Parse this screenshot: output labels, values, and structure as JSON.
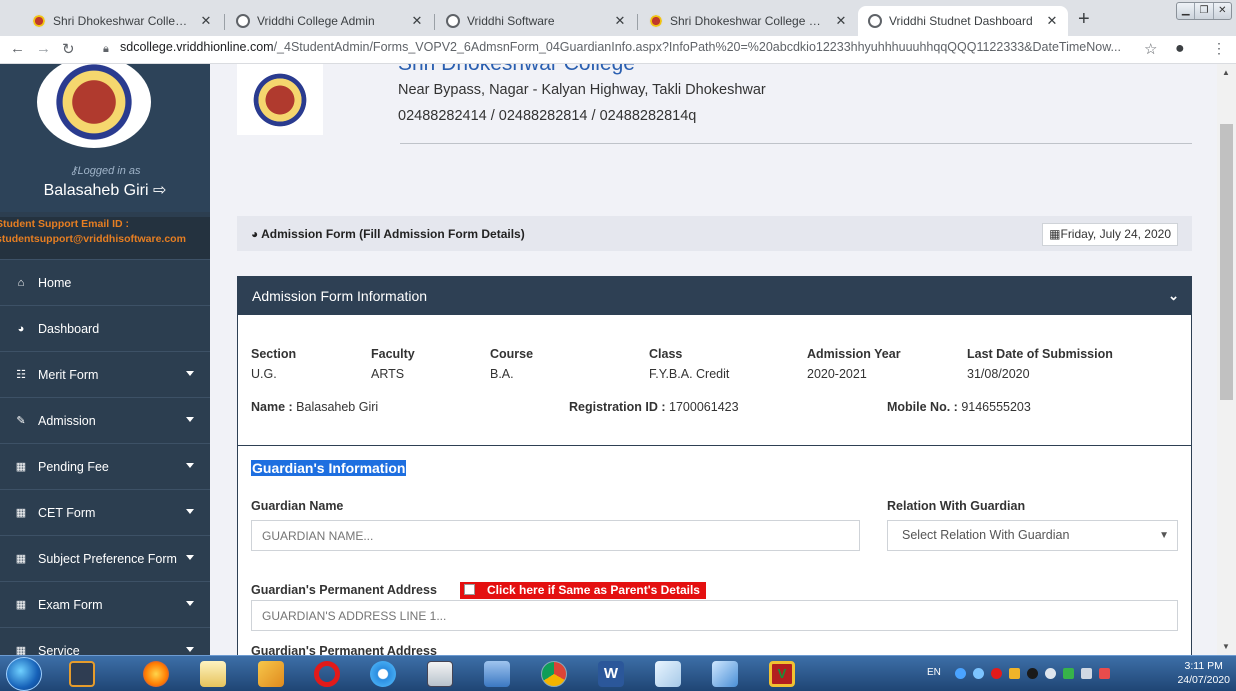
{
  "browser": {
    "tabs": [
      {
        "title": "Shri Dhokeshwar College – A/P. T",
        "active": false
      },
      {
        "title": "Vriddhi College Admin",
        "active": false
      },
      {
        "title": "Vriddhi Software",
        "active": false
      },
      {
        "title": "Shri Dhokeshwar College – A/P. T",
        "active": false
      },
      {
        "title": "Vriddhi Studnet Dashboard",
        "active": true
      }
    ],
    "url_domain": "sdcollege.vriddhionline.com",
    "url_path": "/_4StudentAdmin/Forms_VOPV2_6AdmsnForm_04GuardianInfo.aspx?InfoPath%20=%20abcdkio12233hhyuhhhuuuhhqqQQQ1122333&DateTimeNow..."
  },
  "sidebar": {
    "logged_in_label": "Logged in as",
    "user_name": "Balasaheb Giri",
    "support_line1": "Student Support Email ID :",
    "support_line2": "studentsupport@vriddhisoftware.com",
    "menu": [
      {
        "label": "Home",
        "icon": "home-icon",
        "glyph": "⌂",
        "submenu": false
      },
      {
        "label": "Dashboard",
        "icon": "dashboard-icon",
        "glyph": "◕",
        "submenu": false
      },
      {
        "label": "Merit Form",
        "icon": "merit-form-icon",
        "glyph": "☷",
        "submenu": true
      },
      {
        "label": "Admission",
        "icon": "edit-icon",
        "glyph": "✎",
        "submenu": true
      },
      {
        "label": "Pending Fee",
        "icon": "table-icon",
        "glyph": "▦",
        "submenu": true
      },
      {
        "label": "CET Form",
        "icon": "table-icon",
        "glyph": "▦",
        "submenu": true
      },
      {
        "label": "Subject Preference Form",
        "icon": "table-icon",
        "glyph": "▦",
        "submenu": true
      },
      {
        "label": "Exam Form",
        "icon": "table-icon",
        "glyph": "▦",
        "submenu": true
      },
      {
        "label": "Service",
        "icon": "table-icon",
        "glyph": "▦",
        "submenu": true
      }
    ]
  },
  "header": {
    "college_name": "Shri Dhokeshwar College",
    "address": "Near Bypass, Nagar - Kalyan Highway, Takli Dhokeshwar",
    "phones": "02488282414 / 02488282814 / 02488282814q"
  },
  "form_bar": {
    "title": "Admission Form (Fill Admission Form Details)",
    "date": "Friday, July 24, 2020"
  },
  "panel": {
    "title": "Admission Form Information",
    "columns": [
      {
        "header": "Section",
        "value": "U.G."
      },
      {
        "header": "Faculty",
        "value": "ARTS"
      },
      {
        "header": "Course",
        "value": "B.A."
      },
      {
        "header": "Class",
        "value": "F.Y.B.A. Credit"
      },
      {
        "header": "Admission Year",
        "value": "2020-2021"
      },
      {
        "header": "Last Date of Submission",
        "value": "31/08/2020"
      }
    ],
    "name_label": "Name :",
    "name_value": "Balasaheb Giri",
    "reg_label": "Registration ID :",
    "reg_value": "1700061423",
    "mobile_label": "Mobile No. :",
    "mobile_value": "9146555203"
  },
  "guardian": {
    "section_title": "Guardian's Information",
    "name_label": "Guardian Name",
    "name_placeholder": "GUARDIAN NAME...",
    "relation_label": "Relation With Guardian",
    "relation_selected": "Select Relation With Guardian",
    "address_label": "Guardian's Permanent Address",
    "same_as_parent": "Click here if Same as Parent's Details",
    "address_line1_placeholder": "GUARDIAN'S ADDRESS LINE 1...",
    "address_label_2": "Guardian's Permanent Address"
  },
  "taskbar": {
    "lang": "EN",
    "time": "3:11 PM",
    "date": "24/07/2020"
  }
}
